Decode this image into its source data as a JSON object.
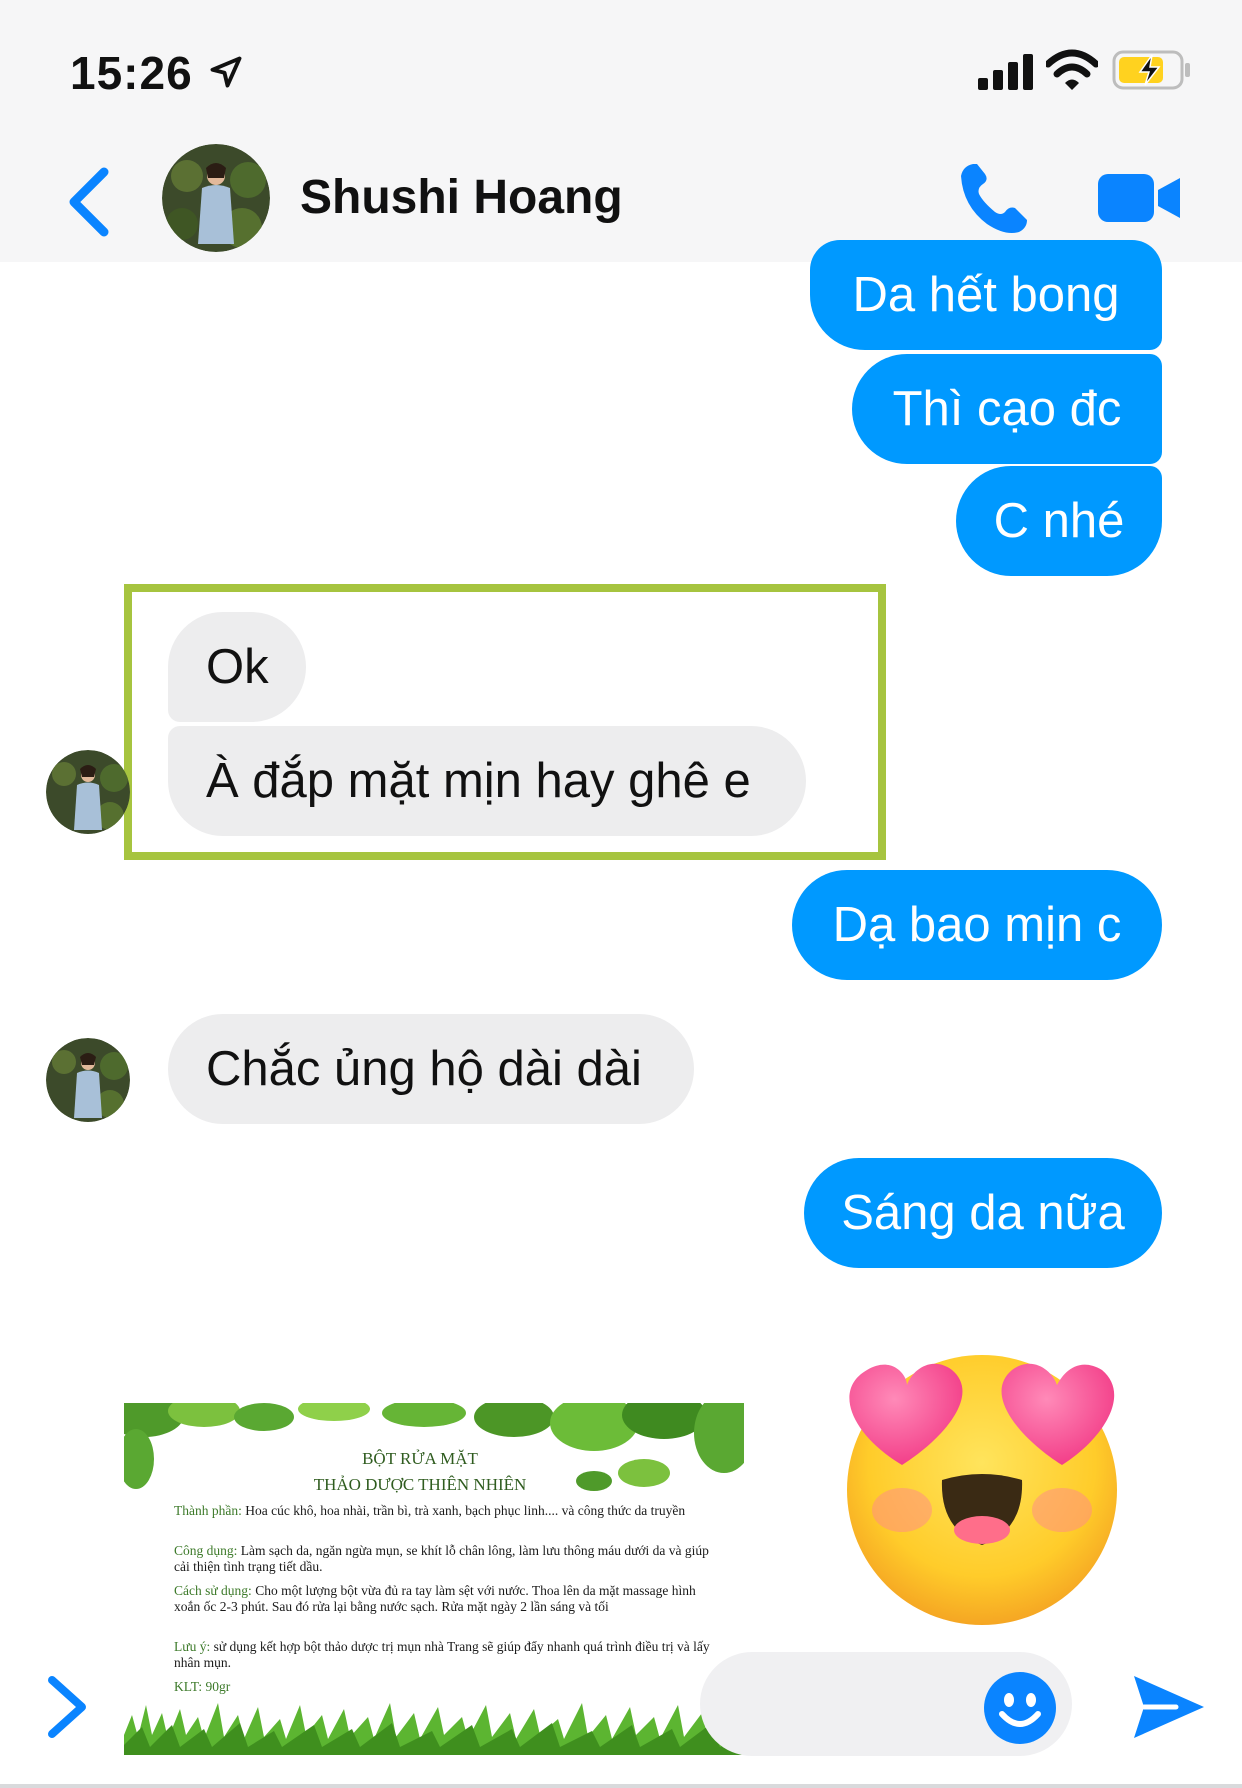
{
  "status_bar": {
    "time": "15:26",
    "icons": [
      "location-arrow-icon",
      "cellular-signal-icon",
      "wifi-icon",
      "battery-charging-icon"
    ]
  },
  "header": {
    "contact_name": "Shushi Hoang",
    "icons": [
      "back-chevron-icon",
      "phone-icon",
      "video-camera-icon"
    ]
  },
  "colors": {
    "outgoing_bubble": "#0099ff",
    "incoming_bubble": "#ededee",
    "accent": "#0099ff",
    "highlight_border": "#a6c43f"
  },
  "messages": [
    {
      "direction": "outgoing",
      "text": "Da hết bong"
    },
    {
      "direction": "outgoing",
      "text": "Thì cạo đc"
    },
    {
      "direction": "outgoing",
      "text": "C nhé"
    },
    {
      "direction": "incoming",
      "text": "Ok"
    },
    {
      "direction": "incoming",
      "text": "À đắp mặt mịn hay ghê e"
    },
    {
      "direction": "outgoing",
      "text": "Dạ bao mịn c"
    },
    {
      "direction": "incoming",
      "text": "Chắc ủng hộ dài dài"
    },
    {
      "direction": "outgoing",
      "text": "Sáng da nữa"
    }
  ],
  "emoji_reaction": "heart-eyes-emoji-icon",
  "product_card": {
    "title_line1": "BỘT RỬA MẶT",
    "title_line2": "THẢO DƯỢC THIÊN NHIÊN",
    "ingredients_label": "Thành phần:",
    "ingredients_text": " Hoa cúc khô, hoa nhài, trần bì, trà xanh, bạch phục linh.... và công thức da truyền",
    "uses_label": "Công dụng:",
    "uses_text": " Làm sạch da, ngăn ngừa mụn, se khít lỗ chân lông, làm lưu thông máu dưới da và giúp cải thiện tình trạng tiết dầu.",
    "usage_label": "Cách sử dụng:",
    "usage_text": " Cho một lượng bột vừa đủ ra tay làm sệt với nước. Thoa lên da mặt massage hình xoắn ốc 2-3 phút. Sau đó rửa lại bằng nước sạch. Rửa mặt ngày 2 lần sáng và tối",
    "note_label": "Lưu ý:",
    "note_text": " sử dụng kết hợp bột thảo dược trị mụn nhà Trang sẽ giúp đẩy nhanh quá trình điều trị và lấy nhân mụn.",
    "weight": "KLT: 90gr"
  },
  "composer": {
    "placeholder": "",
    "icons": [
      "expand-chevron-icon",
      "smiley-icon",
      "send-icon"
    ]
  }
}
